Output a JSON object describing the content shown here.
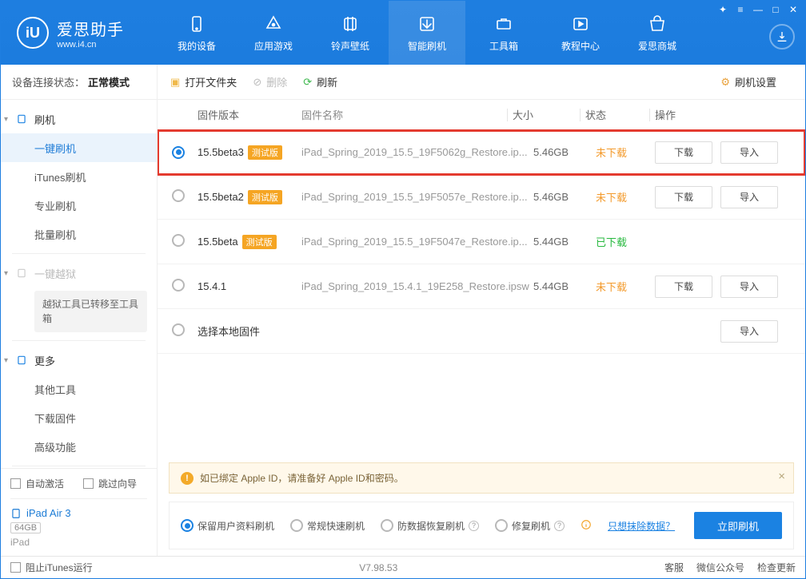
{
  "brand": {
    "name": "爱思助手",
    "url": "www.i4.cn",
    "logo_letter": "iU"
  },
  "topnav": [
    {
      "label": "我的设备"
    },
    {
      "label": "应用游戏"
    },
    {
      "label": "铃声壁纸"
    },
    {
      "label": "智能刷机"
    },
    {
      "label": "工具箱"
    },
    {
      "label": "教程中心"
    },
    {
      "label": "爱思商城"
    }
  ],
  "subtop": {
    "label": "设备连接状态：",
    "value": "正常模式",
    "settings_label": "刷机设置"
  },
  "sidebar": {
    "groups": [
      {
        "title": "刷机",
        "icon": "flash-icon",
        "items": [
          "一键刷机",
          "iTunes刷机",
          "专业刷机",
          "批量刷机"
        ]
      },
      {
        "title": "一键越狱",
        "icon": "lock-icon",
        "disabled": true,
        "note": "越狱工具已转移至工具箱"
      },
      {
        "title": "更多",
        "icon": "more-icon",
        "items": [
          "其他工具",
          "下载固件",
          "高级功能"
        ]
      }
    ],
    "auto_activate": "自动激活",
    "skip_guide": "跳过向导",
    "device": {
      "name": "iPad Air 3",
      "capacity": "64GB",
      "type": "iPad"
    }
  },
  "toolbar": {
    "open": "打开文件夹",
    "delete": "删除",
    "refresh": "刷新",
    "settings": "刷机设置"
  },
  "table": {
    "headers": {
      "version": "固件版本",
      "name": "固件名称",
      "size": "大小",
      "status": "状态",
      "ops": "操作"
    },
    "download_btn": "下载",
    "import_btn": "导入",
    "rows": [
      {
        "version": "15.5beta3",
        "beta": true,
        "name": "iPad_Spring_2019_15.5_19F5062g_Restore.ip...",
        "size": "5.46GB",
        "status": "未下载",
        "status_class": "st-orange",
        "selected": true,
        "download": true,
        "import": true
      },
      {
        "version": "15.5beta2",
        "beta": true,
        "name": "iPad_Spring_2019_15.5_19F5057e_Restore.ip...",
        "size": "5.46GB",
        "status": "未下载",
        "status_class": "st-orange",
        "download": true,
        "import": true
      },
      {
        "version": "15.5beta",
        "beta": true,
        "name": "iPad_Spring_2019_15.5_19F5047e_Restore.ip...",
        "size": "5.44GB",
        "status": "已下载",
        "status_class": "st-green",
        "download": false,
        "import": false
      },
      {
        "version": "15.4.1",
        "beta": false,
        "name": "iPad_Spring_2019_15.4.1_19E258_Restore.ipsw",
        "size": "5.44GB",
        "status": "未下载",
        "status_class": "st-orange",
        "download": true,
        "import": true
      },
      {
        "version": "选择本地固件",
        "beta": false,
        "name": "",
        "size": "",
        "status": "",
        "status_class": "",
        "download": false,
        "import": true,
        "local": true
      }
    ],
    "beta_badge": "测试版"
  },
  "notice": "如已绑定 Apple ID，请准备好 Apple ID和密码。",
  "options": {
    "items": [
      {
        "label": "保留用户资料刷机",
        "selected": true
      },
      {
        "label": "常规快速刷机"
      },
      {
        "label": "防数据恢复刷机",
        "help": true
      },
      {
        "label": "修复刷机",
        "help": true
      }
    ],
    "link": "只想抹除数据？",
    "primary": "立即刷机"
  },
  "statusbar": {
    "block": "阻止iTunes运行",
    "version": "V7.98.53",
    "items": [
      "客服",
      "微信公众号",
      "检查更新"
    ]
  }
}
